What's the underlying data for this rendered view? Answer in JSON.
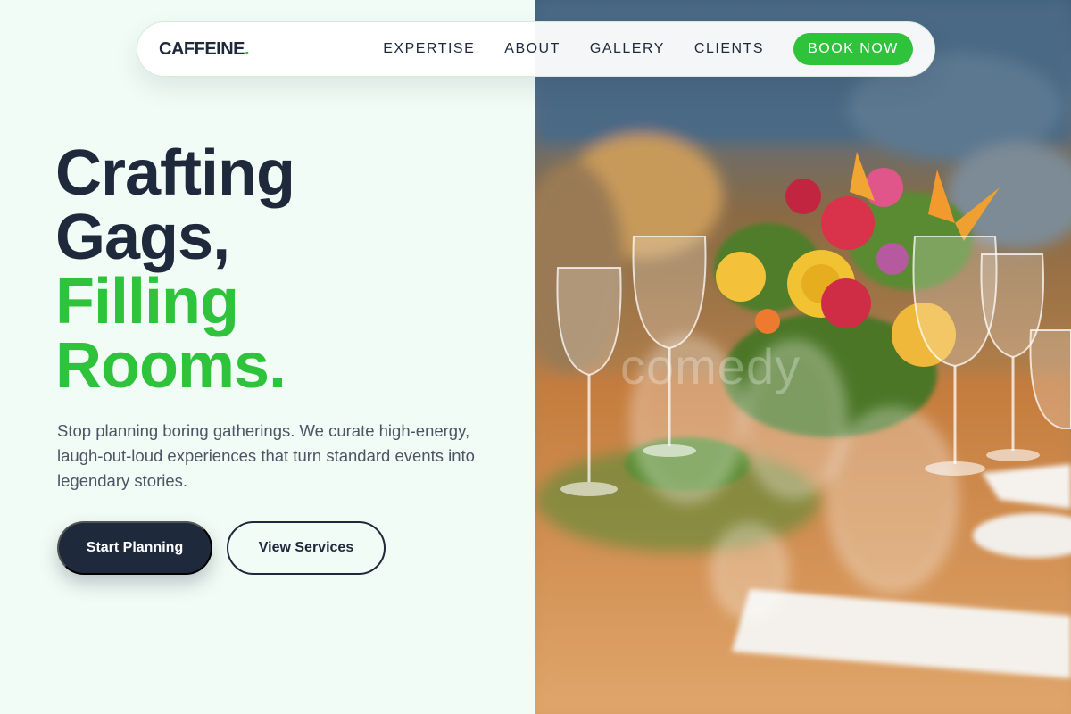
{
  "nav": {
    "logo_text": "CAFFEINE",
    "logo_dot": ".",
    "links": [
      "EXPERTISE",
      "ABOUT",
      "GALLERY",
      "CLIENTS"
    ],
    "cta_label": "BOOK NOW"
  },
  "hero": {
    "headline_line1": "Crafting",
    "headline_line2": "Gags,",
    "headline_line3": "Filling",
    "headline_line4": "Rooms.",
    "subtitle": "Stop planning boring gatherings. We curate high-energy, laugh-out-loud experiences that turn standard events into legendary stories.",
    "primary_button": "Start Planning",
    "secondary_button": "View Services",
    "image_watermark": "comedy"
  },
  "colors": {
    "accent": "#2fc33c",
    "dark": "#1e293b",
    "background": "#f1fcf6",
    "body_text": "#4b5563"
  }
}
